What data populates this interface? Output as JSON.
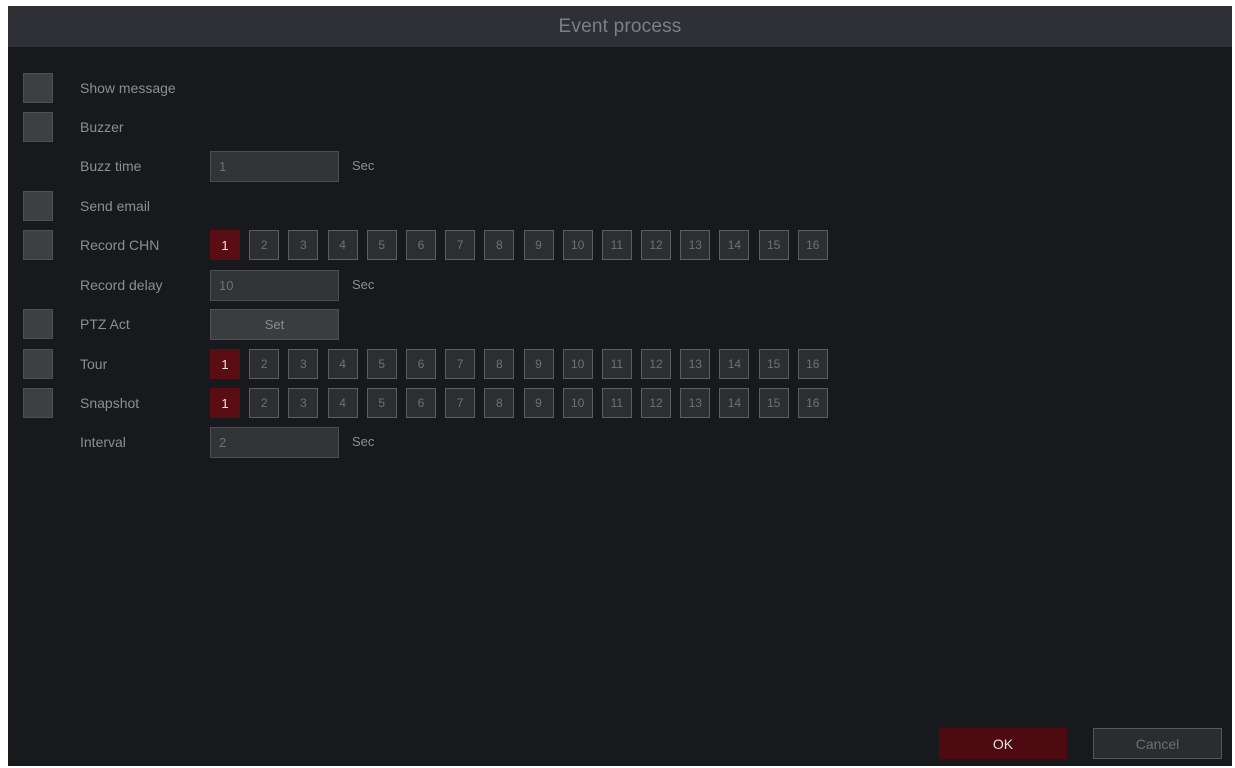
{
  "window": {
    "title": "Event process"
  },
  "rows": {
    "show_message": {
      "label": "Show message"
    },
    "buzzer": {
      "label": "Buzzer"
    },
    "buzz_time": {
      "label": "Buzz time",
      "value": "1",
      "unit": "Sec"
    },
    "send_email": {
      "label": "Send email"
    },
    "record_chn": {
      "label": "Record CHN"
    },
    "record_delay": {
      "label": "Record delay",
      "value": "10",
      "unit": "Sec"
    },
    "ptz_act": {
      "label": "PTZ Act",
      "button": "Set"
    },
    "tour": {
      "label": "Tour"
    },
    "snapshot": {
      "label": "Snapshot"
    },
    "interval": {
      "label": "Interval",
      "value": "2",
      "unit": "Sec"
    }
  },
  "channels": [
    "1",
    "2",
    "3",
    "4",
    "5",
    "6",
    "7",
    "8",
    "9",
    "10",
    "11",
    "12",
    "13",
    "14",
    "15",
    "16"
  ],
  "selected_channel": {
    "record_chn": [
      "1"
    ],
    "tour": [
      "1"
    ],
    "snapshot": [
      "1"
    ]
  },
  "buttons": {
    "ok": "OK",
    "cancel": "Cancel"
  },
  "colors": {
    "accent": "#5a0d12",
    "background": "#17191c",
    "titlebar": "#2e3036"
  }
}
